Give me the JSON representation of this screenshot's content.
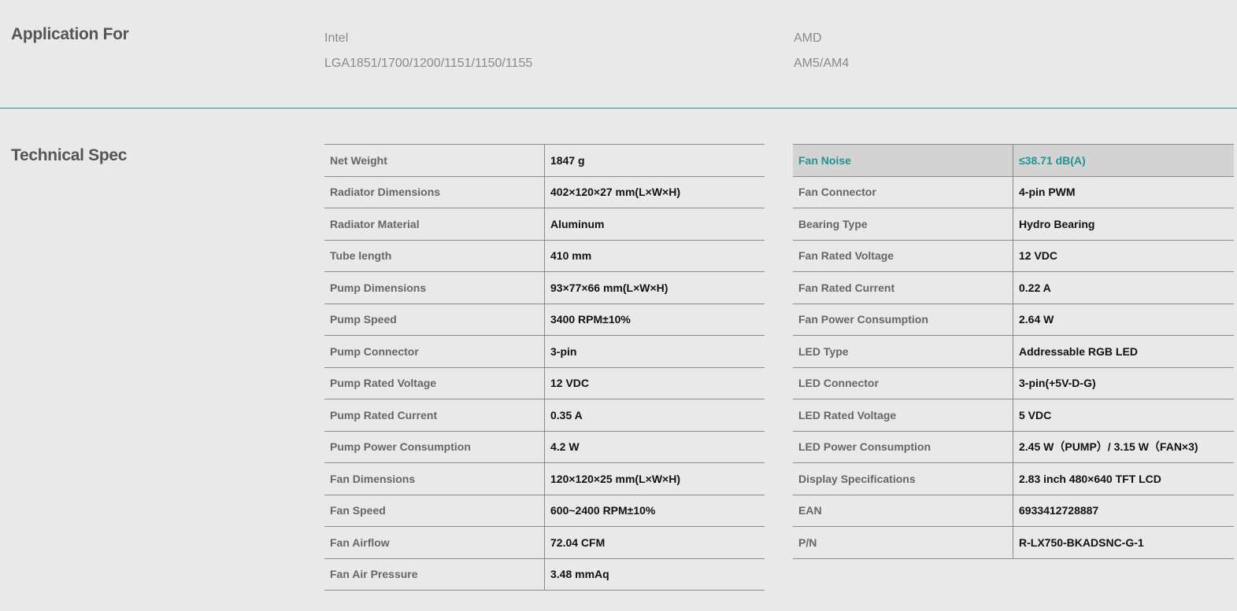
{
  "application": {
    "title": "Application For",
    "intel": {
      "label": "Intel",
      "sockets": "LGA1851/1700/1200/1151/1150/1155"
    },
    "amd": {
      "label": "AMD",
      "sockets": "AM5/AM4"
    }
  },
  "technical_spec": {
    "title": "Technical Spec",
    "left": [
      {
        "label": "Net Weight",
        "value": "1847 g"
      },
      {
        "label": "Radiator Dimensions",
        "value": "402×120×27 mm(L×W×H)"
      },
      {
        "label": "Radiator Material",
        "value": "Aluminum"
      },
      {
        "label": "Tube length",
        "value": "410 mm"
      },
      {
        "label": "Pump Dimensions",
        "value": "93×77×66 mm(L×W×H)"
      },
      {
        "label": "Pump Speed",
        "value": "3400 RPM±10%"
      },
      {
        "label": "Pump Connector",
        "value": "3-pin"
      },
      {
        "label": "Pump Rated Voltage",
        "value": "12 VDC"
      },
      {
        "label": "Pump Rated Current",
        "value": "0.35 A"
      },
      {
        "label": "Pump Power Consumption",
        "value": "4.2 W"
      },
      {
        "label": "Fan Dimensions",
        "value": "120×120×25 mm(L×W×H)"
      },
      {
        "label": "Fan Speed",
        "value": "600~2400 RPM±10%"
      },
      {
        "label": "Fan Airflow",
        "value": "72.04 CFM"
      },
      {
        "label": "Fan Air Pressure",
        "value": "3.48 mmAq"
      }
    ],
    "right": [
      {
        "label": "Fan Noise",
        "value": "≤38.71 dB(A)"
      },
      {
        "label": "Fan Connector",
        "value": "4-pin PWM"
      },
      {
        "label": "Bearing Type",
        "value": "Hydro Bearing"
      },
      {
        "label": "Fan Rated Voltage",
        "value": "12 VDC"
      },
      {
        "label": "Fan Rated Current",
        "value": "0.22 A"
      },
      {
        "label": "Fan Power Consumption",
        "value": "2.64 W"
      },
      {
        "label": "LED Type",
        "value": "Addressable RGB LED"
      },
      {
        "label": "LED Connector",
        "value": "3-pin(+5V-D-G)"
      },
      {
        "label": "LED Rated Voltage",
        "value": "5 VDC"
      },
      {
        "label": "LED Power Consumption",
        "value": "2.45 W（PUMP）/ 3.15 W（FAN×3)"
      },
      {
        "label": "Display Specifications",
        "value": "2.83 inch 480×640 TFT LCD"
      },
      {
        "label": "EAN",
        "value": "6933412728887"
      },
      {
        "label": "P/N",
        "value": "R-LX750-BKADSNC-G-1"
      }
    ]
  },
  "colors": {
    "accent": "#1e9494",
    "background": "#e9e9e9",
    "highlight_row": "#d3d3d3"
  }
}
